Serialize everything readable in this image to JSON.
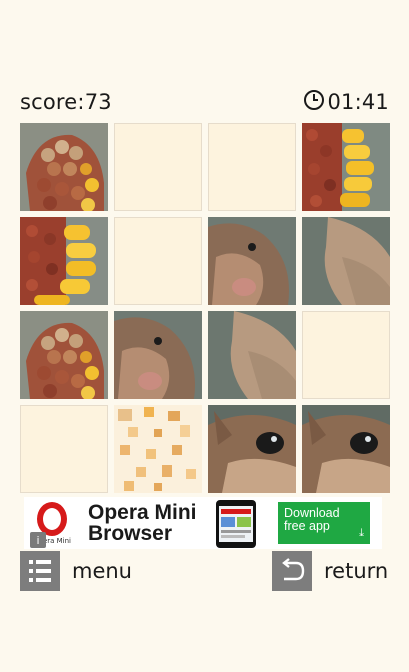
{
  "hud": {
    "score_text": "score:73",
    "timer_text": "01:41",
    "timer_icon": "clock-icon"
  },
  "board": {
    "rows": 4,
    "cols": 4,
    "tiles": [
      [
        "corn-left",
        "blank",
        "blank",
        "corn-right"
      ],
      [
        "corn-left-lower",
        "blank",
        "squirrel-nose",
        "squirrel-cheek"
      ],
      [
        "corn-left",
        "squirrel-nose",
        "squirrel-cheek",
        "blank"
      ],
      [
        "blank",
        "corn-kernels-pale",
        "squirrel-eye",
        "squirrel-eye"
      ]
    ]
  },
  "ad": {
    "brand_small": "Opera Mini",
    "headline_line1": "Opera Mini",
    "headline_line2": "Browser",
    "cta_line1": "Download",
    "cta_line2": "free app",
    "cta_arrow": "⤓",
    "info_icon": "info-icon"
  },
  "footer": {
    "menu_label": "menu",
    "return_label": "return"
  },
  "colors": {
    "background": "#fdf9ee",
    "blank_tile": "#fdf3de",
    "button_gray": "#7d7d7d",
    "ad_green": "#1fa843",
    "opera_red": "#d61a1a"
  }
}
